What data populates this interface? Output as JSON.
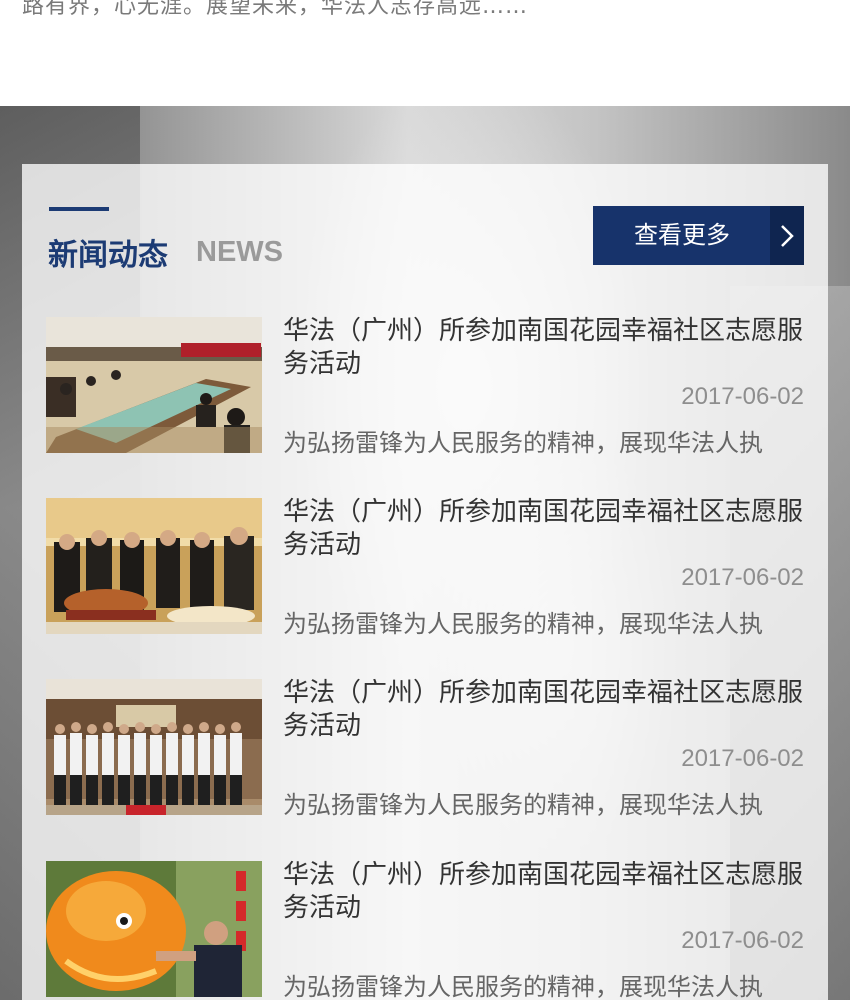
{
  "intro": {
    "text": "路有界，心无涯。展望未来，华法人志存高远……"
  },
  "news_section": {
    "title_cn": "新闻动态",
    "title_en": "NEWS",
    "more_label": "查看更多",
    "items": [
      {
        "title": "华法（广州）所参加南国花园幸福社区志愿服务活动",
        "date": "2017-06-02",
        "summary": "为弘扬雷锋为人民服务的精神，展现华法人执"
      },
      {
        "title": "华法（广州）所参加南国花园幸福社区志愿服务活动",
        "date": "2017-06-02",
        "summary": "为弘扬雷锋为人民服务的精神，展现华法人执"
      },
      {
        "title": "华法（广州）所参加南国花园幸福社区志愿服务活动",
        "date": "2017-06-02",
        "summary": "为弘扬雷锋为人民服务的精神，展现华法人执"
      },
      {
        "title": "华法（广州）所参加南国花园幸福社区志愿服务活动",
        "date": "2017-06-02",
        "summary": "为弘扬雷锋为人民服务的精神，展现华法人执"
      }
    ]
  },
  "colors": {
    "brand": "#17336b",
    "brand_dark": "#0f2550",
    "title_accent": "#1c3b74"
  },
  "icons": {
    "more_arrow": "chevron-right-icon"
  }
}
